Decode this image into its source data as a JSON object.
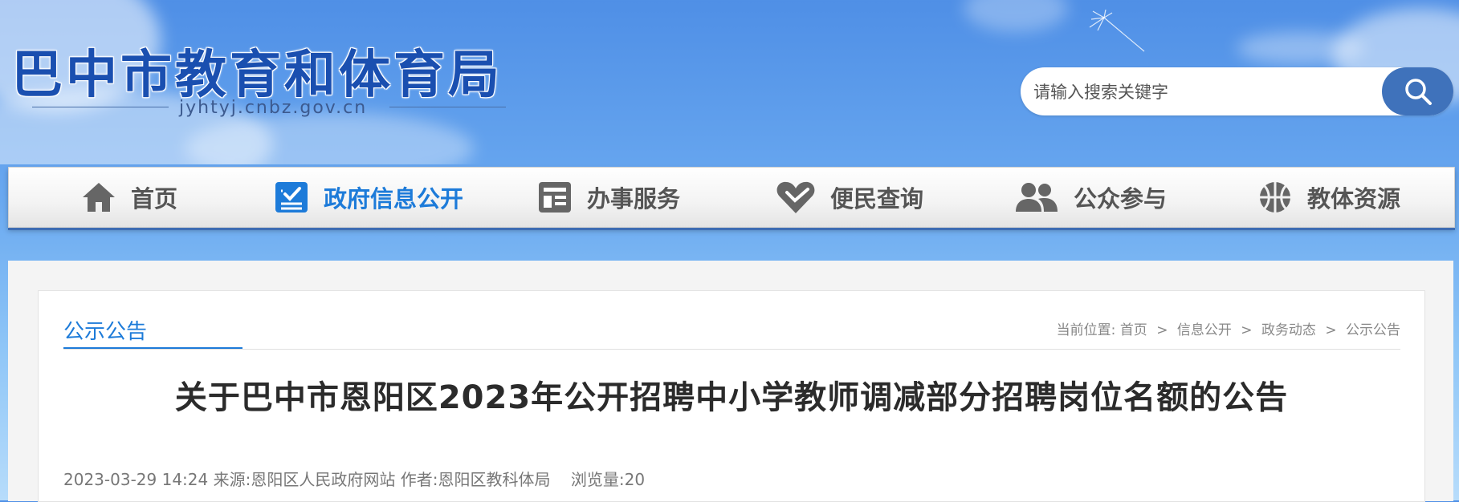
{
  "site": {
    "title": "巴中市教育和体育局",
    "domain": "jyhtyj.cnbz.gov.cn"
  },
  "search": {
    "placeholder": "请输入搜索关键字",
    "button_icon": "search-icon"
  },
  "nav": {
    "items": [
      {
        "label": "首页",
        "icon": "home-icon",
        "active": false
      },
      {
        "label": "政府信息公开",
        "icon": "checklist-icon",
        "active": true
      },
      {
        "label": "办事服务",
        "icon": "document-icon",
        "active": false
      },
      {
        "label": "便民查询",
        "icon": "heart-icon",
        "active": false
      },
      {
        "label": "公众参与",
        "icon": "people-icon",
        "active": false
      },
      {
        "label": "教体资源",
        "icon": "ball-icon",
        "active": false
      }
    ],
    "colors": {
      "active": "#1d7bd9",
      "inactive": "#555555",
      "underline": "#3d6cb3"
    }
  },
  "section": {
    "title": "公示公告"
  },
  "breadcrumb": {
    "prefix": "当前位置:",
    "items": [
      "首页",
      "信息公开",
      "政务动态",
      "公示公告"
    ],
    "separator": ">"
  },
  "article": {
    "title": "关于巴中市恩阳区2023年公开招聘中小学教师调减部分招聘岗位名额的公告",
    "datetime": "2023-03-29 14:24",
    "source_label": "来源:",
    "source": "恩阳区人民政府网站",
    "author_label": "作者:",
    "author": "恩阳区教科体局",
    "views_label": "浏览量:",
    "views": "20"
  }
}
